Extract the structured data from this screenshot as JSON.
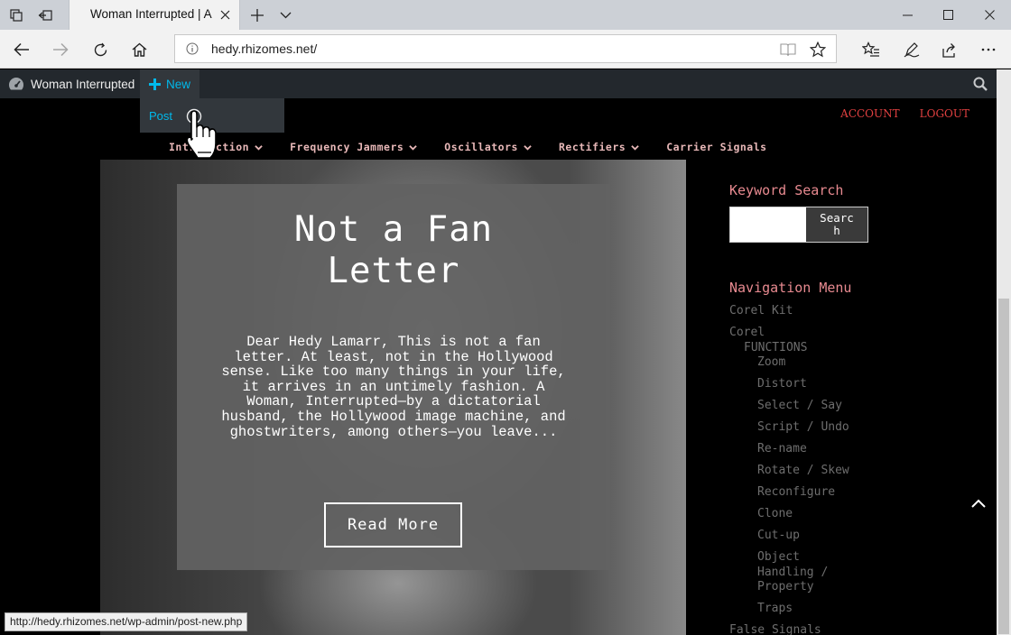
{
  "browser": {
    "tab_title": "Woman Interrupted | A",
    "url": "hedy.rhizomes.net/"
  },
  "adminbar": {
    "site_name": "Woman Interrupted",
    "new_label": "New",
    "dropdown_item": "Post"
  },
  "site": {
    "account_label": "ACCOUNT",
    "logout_label": "LOGOUT",
    "nav_items": [
      {
        "label": "Introduction",
        "has_dropdown": true
      },
      {
        "label": "Frequency Jammers",
        "has_dropdown": true
      },
      {
        "label": "Oscillators",
        "has_dropdown": true
      },
      {
        "label": "Rectifiers",
        "has_dropdown": true
      },
      {
        "label": "Carrier Signals",
        "has_dropdown": false
      }
    ]
  },
  "post": {
    "title_line1": "Not a Fan",
    "title_line2": "Letter",
    "excerpt_lines": [
      "Dear Hedy Lamarr, This is not a fan",
      "letter. At least, not in the Hollywood",
      "sense. Like too many things in your life,",
      "it arrives in an untimely fashion. A",
      "Woman, Interrupted—by a dictatorial",
      "husband, the Hollywood image machine, and",
      "ghostwriters, among others—you leave..."
    ],
    "read_more_label": "Read More"
  },
  "sidebar": {
    "search_title": "Keyword Search",
    "search_button_line1": "Searc",
    "search_button_line2": "h",
    "nav_title": "Navigation Menu",
    "menu": [
      {
        "label": "Corel Kit",
        "level": 0
      },
      {
        "label": "Corel",
        "level": 0
      },
      {
        "label": "FUNCTIONS",
        "level": 1
      },
      {
        "label": "Zoom",
        "level": 2
      },
      {
        "label": "Distort",
        "level": 2
      },
      {
        "label": "Select / Say",
        "level": 2
      },
      {
        "label": "Script / Undo",
        "level": 2
      },
      {
        "label": "Re-name",
        "level": 2
      },
      {
        "label": "Rotate / Skew",
        "level": 2
      },
      {
        "label": "Reconfigure",
        "level": 2
      },
      {
        "label": "Clone",
        "level": 2
      },
      {
        "label": "Cut-up",
        "level": 2
      },
      {
        "label": "Object\nHandling /\nProperty",
        "level": 2
      },
      {
        "label": "Traps",
        "level": 2
      },
      {
        "label": "False Signals",
        "level": 0
      }
    ]
  },
  "status": {
    "link_url": "http://hedy.rhizomes.net/wp-admin/post-new.php"
  },
  "colors": {
    "admin_bar": "#23282d",
    "admin_accent": "#00b9eb",
    "sidebar_title": "#e88a90",
    "top_links": "#e04040"
  }
}
